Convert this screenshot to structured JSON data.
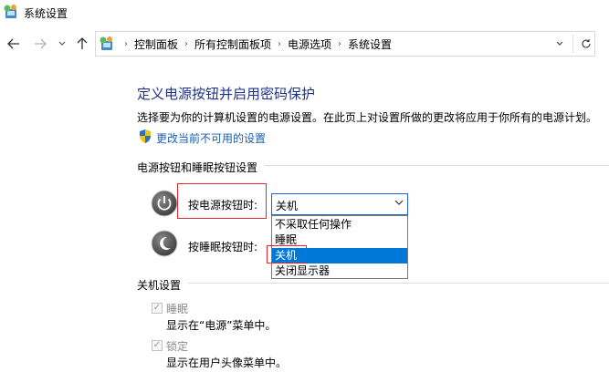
{
  "window": {
    "title": "系统设置",
    "icon": "control-panel-icon"
  },
  "nav": {
    "back_icon": "arrow-left-icon",
    "forward_icon": "arrow-right-icon",
    "recent_icon": "chevron-down-icon",
    "up_icon": "arrow-up-icon",
    "breadcrumb": [
      "控制面板",
      "所有控制面板项",
      "电源选项",
      "系统设置"
    ],
    "separator": "›",
    "dropdown_icon": "chevron-down-icon",
    "refresh_icon": "refresh-icon"
  },
  "main": {
    "title": "定义电源按钮并启用密码保护",
    "description": "选择要为你的计算机设置的电源设置。在此页上对设置所做的更改将应用于你所有的电源计划。",
    "change_link": "更改当前不可用的设置"
  },
  "power_buttons": {
    "section_title": "电源按钮和睡眠按钮设置",
    "power_button_label": "按电源按钮时:",
    "sleep_button_label": "按睡眠按钮时:",
    "power_select_value": "关机",
    "dropdown_options": [
      "不采取任何操作",
      "睡眠",
      "关机",
      "关闭显示器"
    ],
    "selected_option": "关机"
  },
  "shutdown": {
    "section_title": "关机设置",
    "items": [
      {
        "label": "睡眠",
        "description": "显示在“电源”菜单中。",
        "checked": true
      },
      {
        "label": "锁定",
        "description": "显示在用户头像菜单中。",
        "checked": true
      }
    ]
  },
  "colors": {
    "title_blue": "#1e3287",
    "link_blue": "#1a5fb4",
    "highlight_red": "#e8262d",
    "selection_blue": "#0078d7"
  }
}
